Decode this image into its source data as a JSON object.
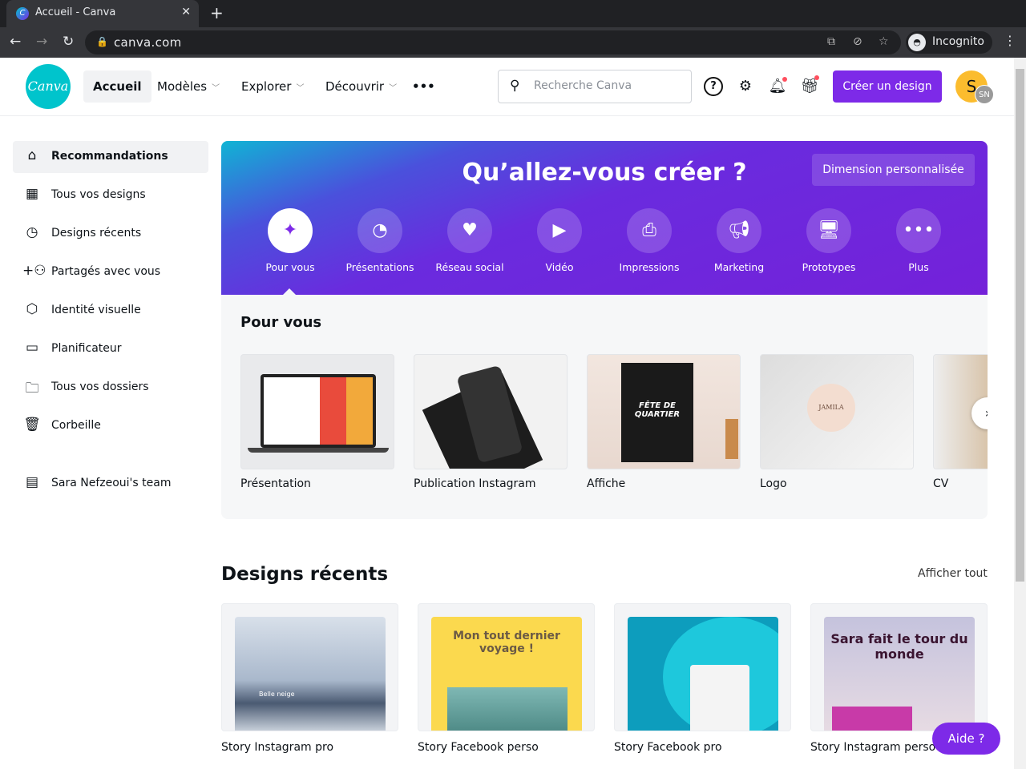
{
  "browser": {
    "tab_title": "Accueil - Canva",
    "favicon": "C",
    "url": "canva.com",
    "profile": "Incognito"
  },
  "header": {
    "logo": "Canva",
    "menu": [
      "Accueil",
      "Modèles",
      "Explorer",
      "Découvrir"
    ],
    "more": "•••",
    "search_placeholder": "Recherche Canva",
    "create": "Créer un design",
    "avatar": "S",
    "team_badge": "SN"
  },
  "sidebar": {
    "items": [
      {
        "label": "Recommandations",
        "icon": "home-icon"
      },
      {
        "label": "Tous vos designs",
        "icon": "grid-icon"
      },
      {
        "label": "Designs récents",
        "icon": "clock-icon"
      },
      {
        "label": "Partagés avec vous",
        "icon": "people-icon"
      },
      {
        "label": "Identité visuelle",
        "icon": "brand-icon"
      },
      {
        "label": "Planificateur",
        "icon": "calendar-icon"
      },
      {
        "label": "Tous vos dossiers",
        "icon": "folder-icon"
      },
      {
        "label": "Corbeille",
        "icon": "trash-icon"
      }
    ],
    "team": "Sara Nefzeoui's team"
  },
  "hero": {
    "title": "Qu’allez-vous créer ?",
    "custom_size": "Dimension personnalisée",
    "categories": [
      "Pour vous",
      "Présentations",
      "Réseau social",
      "Vidéo",
      "Impressions",
      "Marketing",
      "Prototypes",
      "Plus"
    ]
  },
  "for_you": {
    "title": "Pour vous",
    "templates": [
      "Présentation",
      "Publication Instagram",
      "Affiche",
      "Logo",
      "CV"
    ],
    "thumb_texts": {
      "poster": "FÊTE DE QUARTIER",
      "logo": "JAMILA"
    }
  },
  "recent": {
    "title": "Designs récents",
    "show_all": "Afficher tout",
    "designs": [
      "Story Instagram pro",
      "Story Facebook perso",
      "Story Facebook pro",
      "Story Instagram perso"
    ],
    "thumb_texts": {
      "snow": "Belle neige",
      "voyage": "Mon tout dernier voyage !",
      "sara": "Sara fait le tour du monde"
    }
  },
  "help": "Aide  ?",
  "colors": {
    "accent": "#7d2ae8",
    "logo": "#00c4cc"
  }
}
